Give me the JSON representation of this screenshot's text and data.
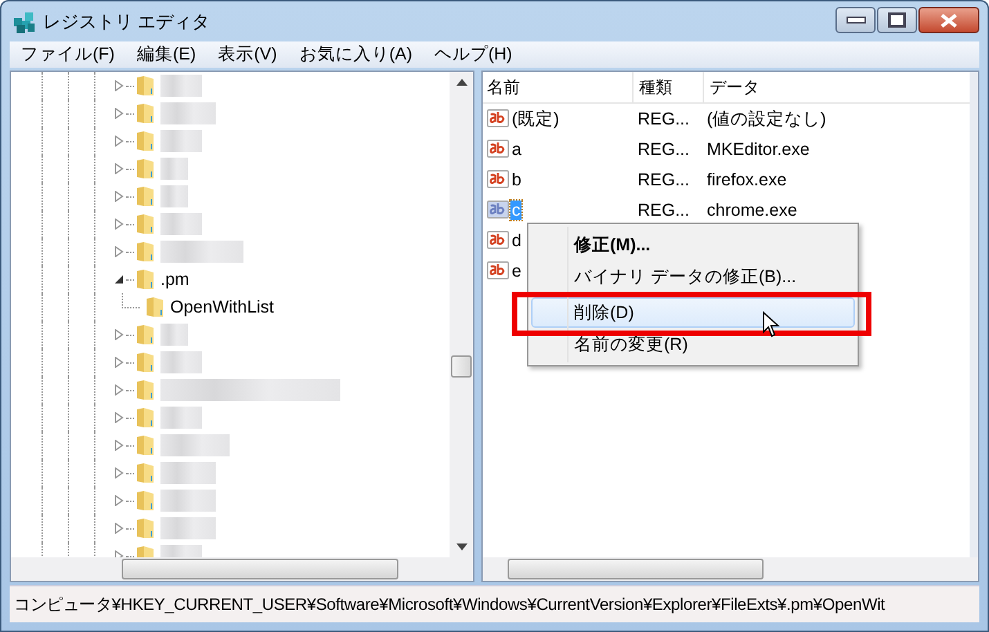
{
  "window": {
    "title": "レジストリ エディタ"
  },
  "menu_bar": [
    "ファイル(F)",
    "編集(E)",
    "表示(V)",
    "お気に入り(A)",
    "ヘルプ(H)"
  ],
  "tree": {
    "items": [
      {
        "kind": "blurred",
        "expanded": false
      },
      {
        "kind": "blurred",
        "expanded": false
      },
      {
        "kind": "blurred",
        "expanded": false
      },
      {
        "kind": "blurred",
        "expanded": false
      },
      {
        "kind": "blurred",
        "expanded": false
      },
      {
        "kind": "blurred",
        "expanded": false
      },
      {
        "kind": "blurred",
        "expanded": false
      },
      {
        "kind": "folder",
        "label": ".pm",
        "expanded": true,
        "children": [
          {
            "kind": "folder",
            "label": "OpenWithList"
          }
        ]
      },
      {
        "kind": "blurred",
        "expanded": false
      },
      {
        "kind": "blurred",
        "expanded": false
      },
      {
        "kind": "blurred",
        "expanded": false
      },
      {
        "kind": "blurred",
        "expanded": false
      },
      {
        "kind": "blurred",
        "expanded": false
      },
      {
        "kind": "blurred",
        "expanded": false
      },
      {
        "kind": "blurred",
        "expanded": false
      },
      {
        "kind": "blurred",
        "expanded": false
      },
      {
        "kind": "blurred",
        "expanded": false
      }
    ]
  },
  "values": {
    "columns": [
      "名前",
      "種類",
      "データ"
    ],
    "rows": [
      {
        "name": "(既定)",
        "type": "REG...",
        "data": "(値の設定なし)",
        "selected": false
      },
      {
        "name": "a",
        "type": "REG...",
        "data": "MKEditor.exe",
        "selected": false
      },
      {
        "name": "b",
        "type": "REG...",
        "data": "firefox.exe",
        "selected": false
      },
      {
        "name": "c",
        "type": "REG...",
        "data": "chrome.exe",
        "selected": true
      },
      {
        "name": "d",
        "selected": false
      },
      {
        "name": "e",
        "selected": false
      }
    ]
  },
  "context_menu": {
    "items": [
      {
        "kind": "item",
        "label": "修正(M)...",
        "default": true,
        "hovered": false,
        "highlighted": false
      },
      {
        "kind": "item",
        "label": "バイナリ データの修正(B)...",
        "default": false,
        "hovered": false,
        "highlighted": false
      },
      {
        "kind": "separator"
      },
      {
        "kind": "item",
        "label": "削除(D)",
        "default": false,
        "hovered": true,
        "highlighted": true
      },
      {
        "kind": "item",
        "label": "名前の変更(R)",
        "default": false,
        "hovered": false,
        "highlighted": false
      }
    ]
  },
  "status_bar": "コンピュータ¥HKEY_CURRENT_USER¥Software¥Microsoft¥Windows¥CurrentVersion¥Explorer¥FileExts¥.pm¥OpenWit"
}
